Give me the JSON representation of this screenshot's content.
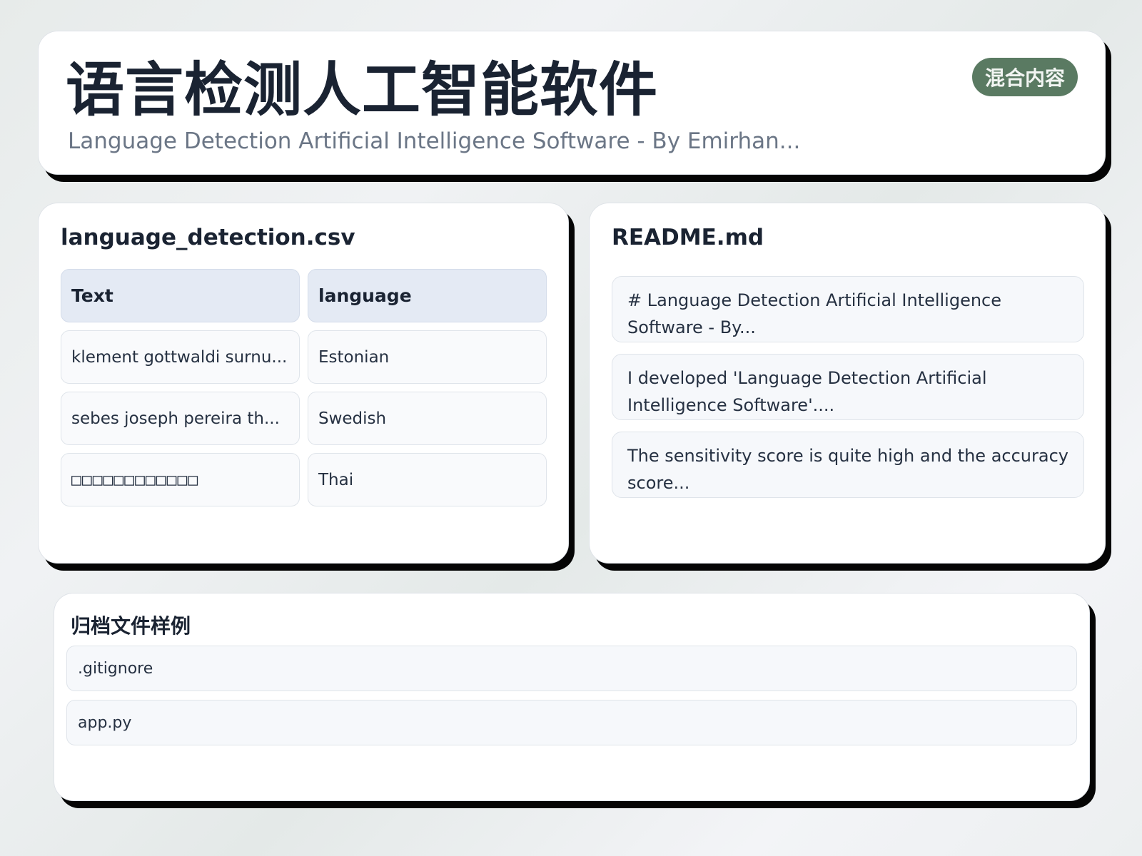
{
  "header": {
    "title": "语言检测人工智能软件",
    "subtitle": "Language Detection Artificial Intelligence Software - By Emirhan...",
    "badge": "混合内容"
  },
  "csv": {
    "filename": "language_detection.csv",
    "columns": [
      "Text",
      "language"
    ],
    "rows": [
      [
        "klement gottwaldi surnu...",
        "Estonian"
      ],
      [
        "sebes joseph pereira th...",
        "Swedish"
      ],
      [
        "□□□□□□□□□□□□",
        "Thai"
      ]
    ]
  },
  "readme": {
    "filename": "README.md",
    "lines": [
      "# Language Detection Artificial Intelligence Software - By...",
      "I developed 'Language Detection Artificial Intelligence Software'....",
      "The sensitivity score is quite high and the accuracy score..."
    ]
  },
  "archive": {
    "title": "归档文件样例",
    "files": [
      ".gitignore",
      "app.py"
    ]
  },
  "colors": {
    "badge_bg": "#5a7a62",
    "header_cell_bg": "#e4eaf4",
    "card_shadow": "#050505"
  }
}
